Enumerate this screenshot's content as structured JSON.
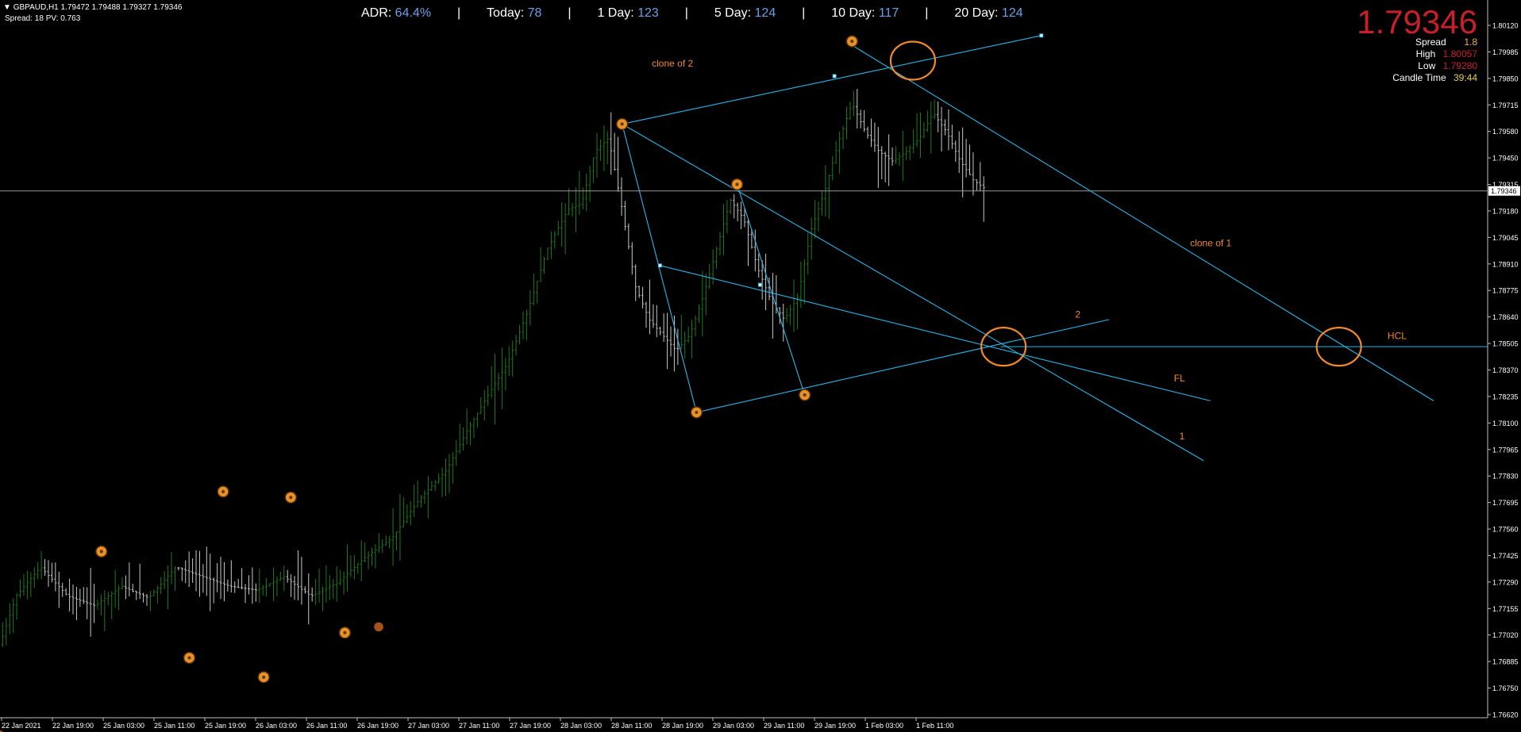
{
  "header": {
    "symbol_line": "GBPAUD,H1  1.79472 1.79488 1.79327 1.79346",
    "spread_line": "Spread: 18   PV: 0.763"
  },
  "adr_bar": {
    "items": [
      {
        "label": "ADR:",
        "value": "64.4%"
      },
      {
        "label": "Today:",
        "value": "78"
      },
      {
        "label": "1 Day:",
        "value": "123"
      },
      {
        "label": "5 Day:",
        "value": "124"
      },
      {
        "label": "10 Day:",
        "value": "117"
      },
      {
        "label": "20 Day:",
        "value": "124"
      }
    ],
    "separator": "|"
  },
  "info_panel": {
    "price": "1.79346",
    "spread_label": "Spread",
    "spread_value": "1.8",
    "high_label": "High",
    "high_value": "1.80057",
    "low_label": "Low",
    "low_value": "1.79280",
    "candle_label": "Candle Time",
    "candle_value": "39:44"
  },
  "colors": {
    "background": "#000000",
    "line": "#29b6e6",
    "label": "#f08a2a",
    "bull_bar": "#1f7a1f",
    "bear_bar": "#c8c8c8",
    "price_red": "#c8202a",
    "adr_value": "#6aa0e8",
    "spread_value": "#f0b040",
    "high_value": "#c8202a",
    "low_value": "#c8202a",
    "candle_value": "#e8d040"
  },
  "chart_data": {
    "type": "line",
    "symbol": "GBPAUD",
    "timeframe": "H1",
    "current_price": 1.79346,
    "current_price_label": "1.79346",
    "ylim": [
      1.7662,
      1.8026
    ],
    "y_ticks": [
      "1.80120",
      "1.79985",
      "1.79850",
      "1.79715",
      "1.79580",
      "1.79450",
      "1.79315",
      "1.79180",
      "1.79045",
      "1.78910",
      "1.78775",
      "1.78640",
      "1.78505",
      "1.78370",
      "1.78235",
      "1.78100",
      "1.77965",
      "1.77830",
      "1.77695",
      "1.77560",
      "1.77425",
      "1.77290",
      "1.77155",
      "1.77020",
      "1.76885",
      "1.76750",
      "1.76620"
    ],
    "x_ticks": [
      "22 Jan 2021",
      "22 Jan 19:00",
      "25 Jan 03:00",
      "25 Jan 11:00",
      "25 Jan 19:00",
      "26 Jan 03:00",
      "26 Jan 11:00",
      "26 Jan 19:00",
      "27 Jan 03:00",
      "27 Jan 11:00",
      "27 Jan 19:00",
      "28 Jan 03:00",
      "28 Jan 11:00",
      "28 Jan 19:00",
      "29 Jan 03:00",
      "29 Jan 11:00",
      "29 Jan 19:00",
      "1 Feb 03:00",
      "1 Feb 11:00"
    ],
    "path_keypoints": [
      [
        0,
        1.77
      ],
      [
        12,
        1.7725
      ],
      [
        30,
        1.774
      ],
      [
        50,
        1.7725
      ],
      [
        70,
        1.772
      ],
      [
        90,
        1.773
      ],
      [
        110,
        1.7724
      ],
      [
        130,
        1.774
      ],
      [
        150,
        1.7735
      ],
      [
        170,
        1.773
      ],
      [
        190,
        1.7728
      ],
      [
        210,
        1.7735
      ],
      [
        230,
        1.7725
      ],
      [
        250,
        1.7732
      ],
      [
        270,
        1.7745
      ],
      [
        290,
        1.7755
      ],
      [
        310,
        1.7775
      ],
      [
        330,
        1.779
      ],
      [
        345,
        1.781
      ],
      [
        360,
        1.7828
      ],
      [
        375,
        1.7845
      ],
      [
        390,
        1.7872
      ],
      [
        405,
        1.7905
      ],
      [
        420,
        1.7925
      ],
      [
        430,
        1.7928
      ],
      [
        440,
        1.7955
      ],
      [
        450,
        1.7962
      ],
      [
        460,
        1.7925
      ],
      [
        470,
        1.7885
      ],
      [
        480,
        1.7868
      ],
      [
        490,
        1.786
      ],
      [
        500,
        1.7852
      ],
      [
        510,
        1.786
      ],
      [
        520,
        1.788
      ],
      [
        530,
        1.7905
      ],
      [
        540,
        1.793
      ],
      [
        550,
        1.792
      ],
      [
        560,
        1.7895
      ],
      [
        570,
        1.7878
      ],
      [
        580,
        1.7868
      ],
      [
        590,
        1.788
      ],
      [
        600,
        1.7915
      ],
      [
        610,
        1.7935
      ],
      [
        620,
        1.796
      ],
      [
        630,
        1.798
      ],
      [
        640,
        1.7965
      ],
      [
        650,
        1.7955
      ],
      [
        660,
        1.795
      ],
      [
        670,
        1.7955
      ],
      [
        680,
        1.7962
      ],
      [
        690,
        1.7975
      ],
      [
        700,
        1.7965
      ],
      [
        710,
        1.795
      ],
      [
        720,
        1.794
      ],
      [
        730,
        1.7935
      ]
    ],
    "pivots": [
      {
        "x": 0,
        "y": 1.7653,
        "style": "small"
      },
      {
        "x": 75,
        "y": 1.7748
      },
      {
        "x": 140,
        "y": 1.7693
      },
      {
        "x": 165,
        "y": 1.7779
      },
      {
        "x": 195,
        "y": 1.7683
      },
      {
        "x": 215,
        "y": 1.7776
      },
      {
        "x": 255,
        "y": 1.7706
      },
      {
        "x": 280,
        "y": 1.7709,
        "style": "small"
      },
      {
        "x": 460,
        "y": 1.79692
      },
      {
        "x": 515,
        "y": 1.782
      },
      {
        "x": 545,
        "y": 1.7938
      },
      {
        "x": 595,
        "y": 1.7829
      },
      {
        "x": 630,
        "y": 1.8012
      }
    ],
    "lines": [
      {
        "name": "clone of 2",
        "from": [
          460,
          1.79692
        ],
        "to": [
          770,
          1.8015
        ],
        "label": "clone of 2"
      },
      {
        "name": "clone of 1",
        "from": [
          630,
          1.801
        ],
        "to": [
          1060,
          1.7826
        ],
        "label": "clone of 1"
      },
      {
        "name": "1",
        "from": [
          460,
          1.79692
        ],
        "to": [
          890,
          1.7795
        ],
        "label": "1"
      },
      {
        "name": "2",
        "from": [
          515,
          1.782
        ],
        "to": [
          820,
          1.7868
        ],
        "label": "2"
      },
      {
        "name": "FL",
        "from": [
          488,
          1.7896
        ],
        "to": [
          895,
          1.7826
        ],
        "label": "FL"
      },
      {
        "name": "HCL",
        "from": [
          740,
          1.7854
        ],
        "to": [
          1100,
          1.7854
        ],
        "label": "HCL"
      },
      {
        "name": "pivot-link-a",
        "from": [
          460,
          1.79692
        ],
        "to": [
          515,
          1.782
        ]
      },
      {
        "name": "pivot-link-b",
        "from": [
          545,
          1.7938
        ],
        "to": [
          595,
          1.7829
        ]
      }
    ],
    "annotation_circles": [
      {
        "x": 675,
        "y": 1.8002
      },
      {
        "x": 742,
        "y": 1.7854
      },
      {
        "x": 990,
        "y": 1.7854
      }
    ]
  }
}
